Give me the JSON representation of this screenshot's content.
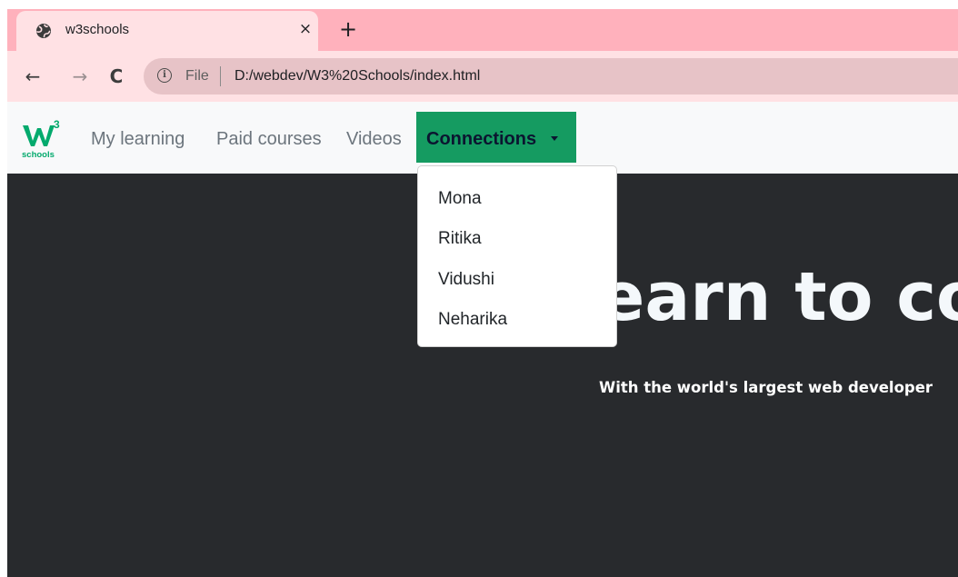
{
  "browser": {
    "tab": {
      "title": "w3schools",
      "close_glyph": "×",
      "favicon": "globe-icon"
    },
    "new_tab_glyph": "+",
    "toolbar": {
      "back_glyph": "←",
      "forward_glyph": "→",
      "reload_glyph": "C"
    },
    "address": {
      "info_glyph": "i",
      "scheme": "File",
      "url": "D:/webdev/W3%20Schools/index.html"
    }
  },
  "site": {
    "logo": {
      "mark": "W",
      "superscript": "3",
      "wordmark": "schools"
    },
    "nav": {
      "items": [
        "My learning",
        "Paid courses",
        "Videos"
      ],
      "dropdown": {
        "label": "Connections",
        "items": [
          "Mona",
          "Ritika",
          "Vidushi",
          "Neharika"
        ]
      }
    },
    "hero": {
      "title": "Learn to co",
      "subtitle": "With the world's largest web developer"
    }
  },
  "colors": {
    "tabbar": "#ffb1bc",
    "toolbar": "#ffe1e4",
    "navbar": "#f8f9fa",
    "brand_green": "#04aa6d",
    "dropdown_active": "#159b61",
    "hero_bg": "#282a2d"
  }
}
